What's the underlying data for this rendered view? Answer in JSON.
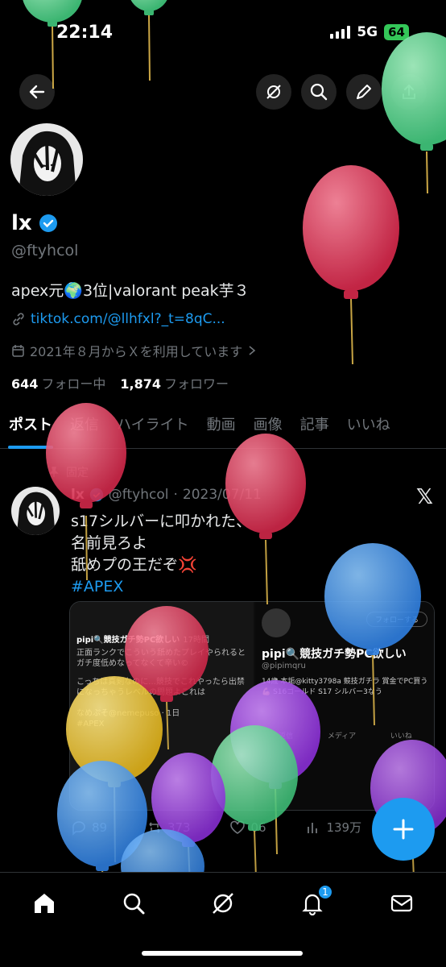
{
  "status_bar": {
    "time": "22:14",
    "network": "5G",
    "battery": "64"
  },
  "profile": {
    "name": "lx",
    "handle": "@ftyhcol",
    "bio": "apex元🌍3位|valorant peak芋３",
    "link": "tiktok.com/@llhfxl?_t=8qC...",
    "joined": "2021年８月からＸを利用しています",
    "following_count": "644",
    "following_label": "フォロー中",
    "followers_count": "1,874",
    "followers_label": "フォロワー"
  },
  "tabs": [
    "ポスト",
    "返信",
    "ハイライト",
    "動画",
    "画像",
    "記事",
    "いいね"
  ],
  "pinned_label": "固定",
  "post": {
    "name": "lx",
    "handle": "@ftyhcol",
    "date": "2023/07/11",
    "lines": [
      "s17シルバーに叩かれた、",
      "名前見ろよ",
      "舐めプの王だぞ💢"
    ],
    "hashtag": "#APEX",
    "replies": "89",
    "reposts": "373",
    "likes": "06",
    "views": "139万"
  },
  "card": {
    "left_title": "pipi🔍競技ガチ勢PC欲しい",
    "left_time": "17時間",
    "left_text": "正面ランクでこういう舐めたプレイやられるとガチ度低めなってなくて辛い©",
    "left_text2": "こっちは真剣なのに...競技でこれやったら出禁になっちゃうレベルの問題よこれは",
    "left_reply": "なめぷそ@nemepuso · 1日",
    "left_hashtag": "#APEX",
    "right_name": "pipi🔍競技ガチ勢PC欲しい",
    "right_handle": "@pipimqru",
    "right_follow": "フォローする",
    "right_bio": "14歳 本垢@kitty3798a 競技ガチラ 賞金でPC買う 💪 S16ゴールド S17 シルバー3なう",
    "right_tabs": [
      "返信",
      "メディア",
      "いいね"
    ]
  },
  "nav": {
    "notifications_badge": "1"
  },
  "colors": {
    "accent": "#1d9bf0",
    "background": "#000000",
    "muted": "#71767b"
  }
}
